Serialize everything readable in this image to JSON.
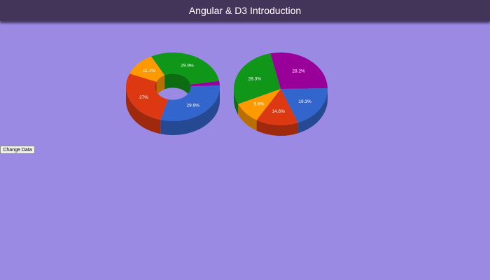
{
  "header": {
    "title": "Angular & D3 Introduction"
  },
  "controls": {
    "change_data_label": "Change Data"
  },
  "colors": {
    "background": "#9b8ae3",
    "header": "#43345a",
    "blue": "#3366cc",
    "red": "#dc3912",
    "orange": "#ff9900",
    "green": "#109618",
    "purple": "#990099"
  },
  "chart_data": [
    {
      "type": "pie",
      "variant": "3d-donut",
      "title": "",
      "slices": [
        {
          "label": "29.9%",
          "value": 29.9,
          "color": "#3366cc"
        },
        {
          "label": "27%",
          "value": 27.0,
          "color": "#dc3912"
        },
        {
          "label": "11.1%",
          "value": 11.1,
          "color": "#ff9900"
        },
        {
          "label": "29.9%",
          "value": 29.9,
          "color": "#109618"
        },
        {
          "label": "",
          "value": 2.1,
          "color": "#990099"
        }
      ]
    },
    {
      "type": "pie",
      "variant": "3d-pie",
      "title": "",
      "slices": [
        {
          "label": "19.3%",
          "value": 19.3,
          "color": "#3366cc"
        },
        {
          "label": "14.6%",
          "value": 14.6,
          "color": "#dc3912"
        },
        {
          "label": "9.6%",
          "value": 9.6,
          "color": "#ff9900"
        },
        {
          "label": "28.3%",
          "value": 28.3,
          "color": "#109618"
        },
        {
          "label": "28.2%",
          "value": 28.2,
          "color": "#990099"
        }
      ]
    }
  ]
}
